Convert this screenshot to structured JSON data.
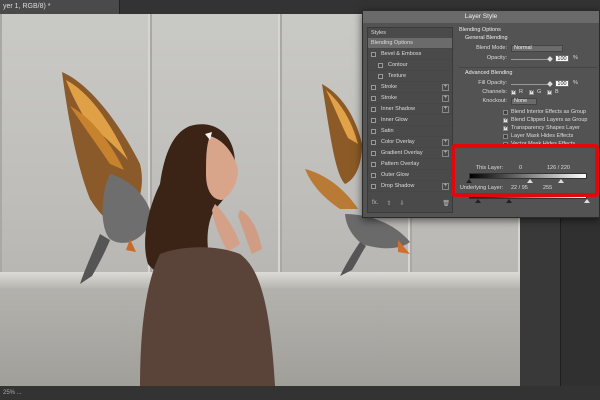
{
  "document": {
    "tab_title": "yer 1, RGB/8) *",
    "status_text": "25% ..."
  },
  "dialog": {
    "title": "Layer Style",
    "styles_header": "Styles",
    "style_items": [
      {
        "label": "Blending Options",
        "selected": true,
        "checkbox": false,
        "plus": false,
        "sub": false
      },
      {
        "label": "Bevel & Emboss",
        "selected": false,
        "checkbox": true,
        "plus": false,
        "sub": false
      },
      {
        "label": "Contour",
        "selected": false,
        "checkbox": true,
        "plus": false,
        "sub": true
      },
      {
        "label": "Texture",
        "selected": false,
        "checkbox": true,
        "plus": false,
        "sub": true
      },
      {
        "label": "Stroke",
        "selected": false,
        "checkbox": true,
        "plus": true,
        "sub": false
      },
      {
        "label": "Stroke",
        "selected": false,
        "checkbox": true,
        "plus": true,
        "sub": false
      },
      {
        "label": "Inner Shadow",
        "selected": false,
        "checkbox": true,
        "plus": true,
        "sub": false
      },
      {
        "label": "Inner Glow",
        "selected": false,
        "checkbox": true,
        "plus": false,
        "sub": false
      },
      {
        "label": "Satin",
        "selected": false,
        "checkbox": true,
        "plus": false,
        "sub": false
      },
      {
        "label": "Color Overlay",
        "selected": false,
        "checkbox": true,
        "plus": true,
        "sub": false
      },
      {
        "label": "Gradient Overlay",
        "selected": false,
        "checkbox": true,
        "plus": true,
        "sub": false
      },
      {
        "label": "Pattern Overlay",
        "selected": false,
        "checkbox": true,
        "plus": false,
        "sub": false
      },
      {
        "label": "Outer Glow",
        "selected": false,
        "checkbox": true,
        "plus": false,
        "sub": false
      },
      {
        "label": "Drop Shadow",
        "selected": false,
        "checkbox": true,
        "plus": true,
        "sub": false
      }
    ],
    "footer": {
      "fx": "fx.",
      "up": "⇧",
      "down": "⇩",
      "trash": "🗑"
    },
    "blending_options_title": "Blending Options",
    "general_blending_title": "General Blending",
    "blend_mode_label": "Blend Mode:",
    "blend_mode_value": "Normal",
    "opacity_label": "Opacity:",
    "opacity_value": "100",
    "percent": "%",
    "advanced_title": "Advanced Blending",
    "fill_opacity_label": "Fill Opacity:",
    "fill_opacity_value": "100",
    "channels_label": "Channels:",
    "channels": [
      {
        "label": "R",
        "checked": true
      },
      {
        "label": "G",
        "checked": true
      },
      {
        "label": "B",
        "checked": true
      }
    ],
    "knockout_label": "Knockout:",
    "knockout_value": "None",
    "options": [
      {
        "label": "Blend Interior Effects as Group",
        "checked": false
      },
      {
        "label": "Blend Clipped Layers as Group",
        "checked": true
      },
      {
        "label": "Transparency Shapes Layer",
        "checked": true
      },
      {
        "label": "Layer Mask Hides Effects",
        "checked": false
      },
      {
        "label": "Vector Mask Hides Effects",
        "checked": false
      }
    ],
    "this_layer_label": "This Layer:",
    "this_layer_values": {
      "low": "0",
      "split": "126 / 220"
    },
    "underlying_label": "Underlying Layer:",
    "underlying_values": {
      "split": "22 / 95",
      "high": "255"
    }
  },
  "colors": {
    "highlight": "#e5060a",
    "dialog_bg": "#535353",
    "app_bg": "#2b2b2b"
  }
}
